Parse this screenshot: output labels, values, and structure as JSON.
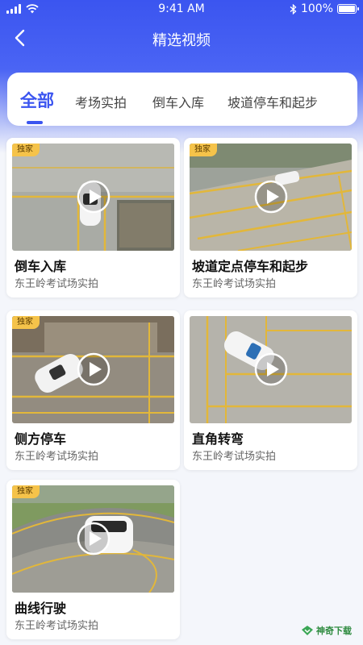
{
  "status": {
    "time": "9:41 AM",
    "battery": "100%",
    "battery_level": 1.0
  },
  "nav": {
    "title": "精选视频"
  },
  "tabs": [
    {
      "label": "全部",
      "active": true
    },
    {
      "label": "考场实拍",
      "active": false
    },
    {
      "label": "倒车入库",
      "active": false
    },
    {
      "label": "坡道停车和起步",
      "active": false
    }
  ],
  "videos": [
    {
      "badge": "独家",
      "title": "倒车入库",
      "subtitle": "东王岭考试场实拍"
    },
    {
      "badge": "独家",
      "title": "坡道定点停车和起步",
      "subtitle": "东王岭考试场实拍"
    },
    {
      "badge": "独家",
      "title": "侧方停车",
      "subtitle": "东王岭考试场实拍"
    },
    {
      "badge": "",
      "title": "直角转弯",
      "subtitle": "东王岭考试场实拍"
    },
    {
      "badge": "独家",
      "title": "曲线行驶",
      "subtitle": "东王岭考试场实拍"
    }
  ],
  "watermark": {
    "text": "神奇下载"
  },
  "colors": {
    "primary": "#3b55f0",
    "badge": "#f5c34a"
  }
}
